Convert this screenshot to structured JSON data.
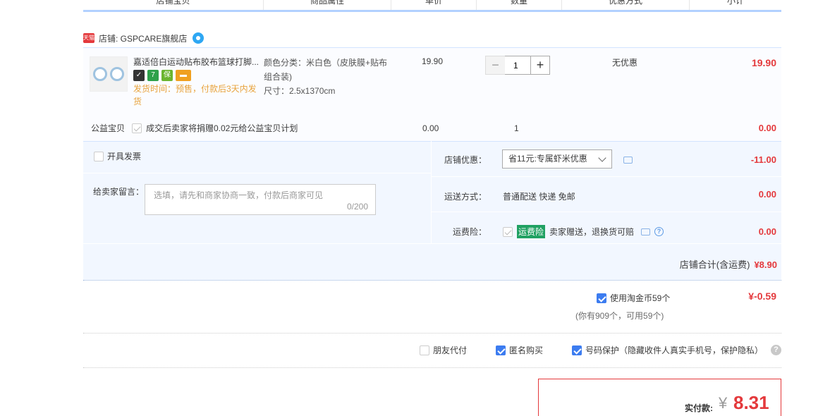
{
  "header": {
    "cols": [
      "店铺宝贝",
      "商品属性",
      "单价",
      "数量",
      "优惠方式",
      "小计"
    ]
  },
  "shop": {
    "mall_tag": "天猫",
    "name": "店铺: GSPCARE旗舰店"
  },
  "item": {
    "title": "嘉适倍白运动贴布胶布篮球打脚...",
    "badges": [
      "7",
      "保"
    ],
    "shipping": "发货时间：预售，付款后3天内发货",
    "attr_color": "颜色分类：米白色（皮肤膜+贴布组合装)",
    "attr_size": "尺寸：2.5x1370cm",
    "price": "19.90",
    "qty": "1",
    "discount": "无优惠",
    "subtotal": "19.90"
  },
  "charity": {
    "label": "公益宝贝",
    "text": "成交后卖家将捐赠0.02元给公益宝贝计划",
    "price": "0.00",
    "qty": "1",
    "subtotal": "0.00"
  },
  "options": {
    "invoice_label": "开具发票",
    "message_label": "给卖家留言：",
    "message_placeholder": "选填，请先和商家协商一致，付款后商家可见",
    "message_count": "0/200",
    "shop_discount_label": "店铺优惠：",
    "shop_discount_value": "省11元:专属虾米优惠",
    "shop_discount_amount": "-11.00",
    "delivery_label": "运送方式：",
    "delivery_value": "普通配送 快递 免邮",
    "delivery_amount": "0.00",
    "insurance_label": "运费险：",
    "insurance_tag": "运费险",
    "insurance_text": "卖家赠送，退换货可赔",
    "insurance_amount": "0.00",
    "total_label": "店铺合计(含运费)",
    "total_value": "¥8.90"
  },
  "coins": {
    "label": "使用淘金币59个",
    "sub": "(你有909个，可用59个)",
    "amount": "¥-0.59"
  },
  "extras": {
    "friend_pay": "朋友代付",
    "anonymous": "匿名购买",
    "number_protect": "号码保护（隐藏收件人真实手机号，保护隐私）"
  },
  "payment": {
    "label": "实付款:",
    "currency": "¥",
    "value": "8.31"
  },
  "colors": {
    "accent_red": "#e4393c",
    "header_line": "#b2d1ff",
    "panel_bg": "#f2f7ff",
    "checkbox_blue": "#3c7cf0"
  }
}
